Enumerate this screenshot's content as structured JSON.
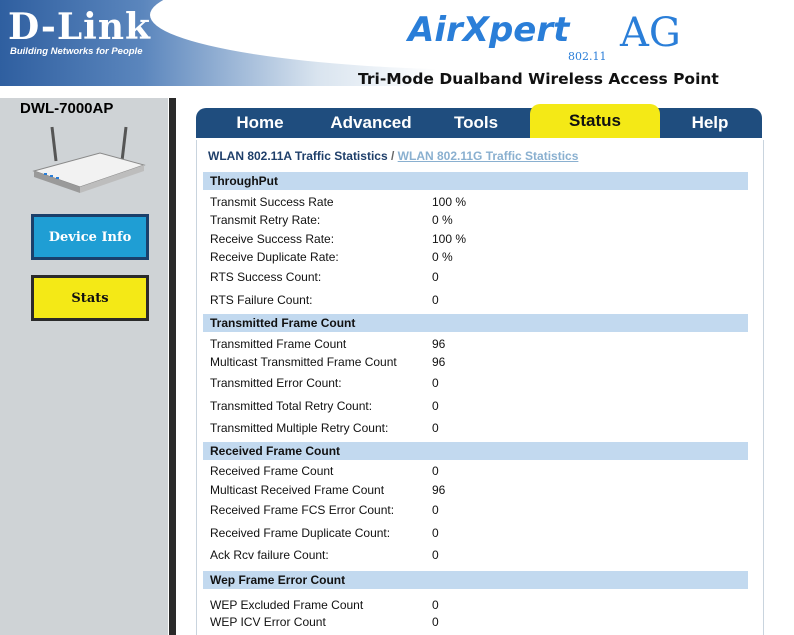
{
  "header": {
    "logo": "D-Link",
    "logo_tagline": "Building Networks for People",
    "brand": "AirXpert",
    "brand_suffix": "AG",
    "brand_standard": "802.11",
    "product_tagline": "Tri-Mode Dualband Wireless Access Point"
  },
  "sidebar": {
    "model": "DWL-7000AP",
    "buttons": [
      {
        "label": "Device Info"
      },
      {
        "label": "Stats"
      }
    ]
  },
  "tabs": [
    {
      "label": "Home"
    },
    {
      "label": "Advanced"
    },
    {
      "label": "Tools"
    },
    {
      "label": "Status",
      "active": true
    },
    {
      "label": "Help"
    }
  ],
  "breadcrumb": {
    "current": "WLAN 802.11A Traffic Statistics",
    "separator": "/",
    "link": "WLAN 802.11G Traffic Statistics"
  },
  "sections": [
    {
      "title": "ThroughPut",
      "rows": [
        {
          "label": "Transmit Success Rate",
          "value": "100  %"
        },
        {
          "label": "Transmit Retry Rate:",
          "value": "0  %"
        },
        {
          "label": "Receive Success Rate:",
          "value": "100  %"
        },
        {
          "label": "Receive Duplicate Rate:",
          "value": "0  %"
        },
        {
          "label": "RTS Success Count:",
          "value": "0"
        },
        {
          "label": "RTS Failure Count:",
          "value": "0"
        }
      ]
    },
    {
      "title": "Transmitted Frame Count",
      "rows": [
        {
          "label": "Transmitted Frame Count",
          "value": "96"
        },
        {
          "label": "Multicast Transmitted Frame Count",
          "value": "96"
        },
        {
          "label": "Transmitted Error Count:",
          "value": "0"
        },
        {
          "label": "Transmitted Total Retry Count:",
          "value": "0"
        },
        {
          "label": "Transmitted Multiple Retry Count:",
          "value": "0"
        }
      ]
    },
    {
      "title": "Received Frame Count",
      "rows": [
        {
          "label": "Received Frame Count",
          "value": "0"
        },
        {
          "label": "Multicast Received Frame Count",
          "value": "96"
        },
        {
          "label": "Received Frame FCS Error Count:",
          "value": "0"
        },
        {
          "label": "Received Frame Duplicate Count:",
          "value": "0"
        },
        {
          "label": "Ack Rcv failure Count:",
          "value": "0"
        }
      ]
    },
    {
      "title": "Wep Frame Error Count",
      "rows": [
        {
          "label": "WEP Excluded Frame Count",
          "value": "0"
        },
        {
          "label": "WEP ICV Error Count",
          "value": "0"
        }
      ]
    }
  ],
  "colors": {
    "section_bg": "#c2d9ef",
    "tab_bar": "#1f4d7e",
    "tab_active": "#f4e916",
    "device_info_button": "#1f9ed4",
    "stats_button": "#f4e916"
  }
}
